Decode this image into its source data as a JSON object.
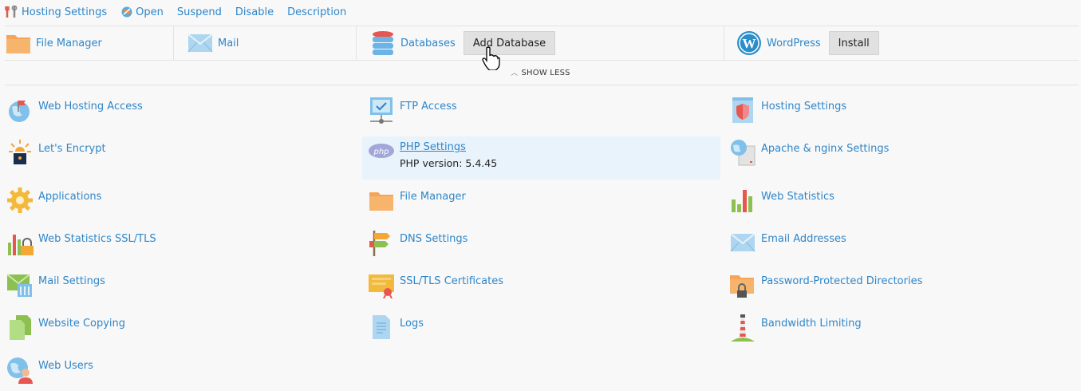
{
  "toolbar": {
    "hosting_settings": "Hosting Settings",
    "open": "Open",
    "suspend": "Suspend",
    "disable": "Disable",
    "description": "Description"
  },
  "quickbar": {
    "file_manager": "File Manager",
    "mail": "Mail",
    "databases": "Databases",
    "add_database": "Add Database",
    "wordpress": "WordPress",
    "install": "Install"
  },
  "show_less": "SHOW LESS",
  "tools": {
    "web_hosting_access": "Web Hosting Access",
    "ftp_access": "FTP Access",
    "hosting_settings": "Hosting Settings",
    "lets_encrypt": "Let's Encrypt",
    "php_settings": "PHP Settings",
    "php_version": "PHP version: 5.4.45",
    "apache_nginx": "Apache & nginx Settings",
    "applications": "Applications",
    "file_manager": "File Manager",
    "web_statistics": "Web Statistics",
    "web_statistics_ssl": "Web Statistics SSL/TLS",
    "dns_settings": "DNS Settings",
    "email_addresses": "Email Addresses",
    "mail_settings": "Mail Settings",
    "ssl_certificates": "SSL/TLS Certificates",
    "password_protected": "Password-Protected Directories",
    "website_copying": "Website Copying",
    "logs": "Logs",
    "bandwidth_limiting": "Bandwidth Limiting",
    "web_users": "Web Users"
  },
  "colors": {
    "link": "#2f86c9",
    "highlight_bg": "#e9f3fb",
    "folder": "#f5a45a"
  }
}
